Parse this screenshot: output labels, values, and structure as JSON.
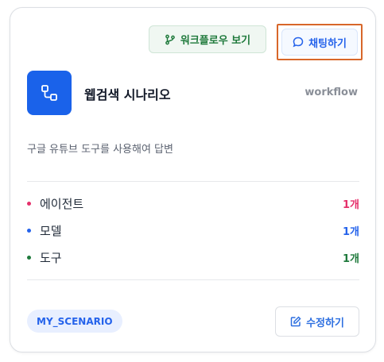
{
  "header": {
    "workflow_button_label": "워크플로우 보기",
    "chat_button_label": "채팅하기"
  },
  "card": {
    "title": "웹검색 시나리오",
    "type_tag": "workflow",
    "description": "구글 유튜브 도구를 사용해여 답변"
  },
  "stats": [
    {
      "label": "에이전트",
      "count": "1개",
      "color": "#e5306b"
    },
    {
      "label": "모델",
      "count": "1개",
      "color": "#2563eb"
    },
    {
      "label": "도구",
      "count": "1개",
      "color": "#1f7a3c"
    }
  ],
  "footer": {
    "badge": "MY_SCENARIO",
    "edit_button_label": "수정하기"
  },
  "colors": {
    "accent_blue": "#1a62ea",
    "workflow_green": "#1f7a3c",
    "highlight_orange": "#d8672a"
  },
  "icons": {
    "workflow": "git-branch-icon",
    "chat": "chat-bubble-icon",
    "app": "workflow-nodes-icon",
    "edit": "edit-icon"
  }
}
